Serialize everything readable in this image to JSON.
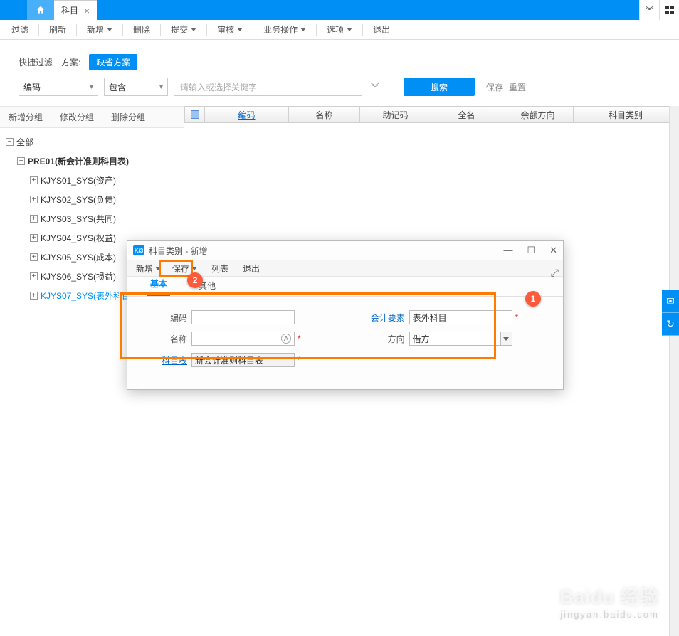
{
  "tabs": {
    "main_label": "科目"
  },
  "toolbar": {
    "filter": "过滤",
    "refresh": "刷新",
    "new": "新增",
    "delete": "删除",
    "submit": "提交",
    "audit": "审核",
    "bizops": "业务操作",
    "options": "选项",
    "exit": "退出"
  },
  "quickfilter": {
    "label": "快捷过滤",
    "scheme_label": "方案:",
    "scheme_value": "缺省方案"
  },
  "search": {
    "field": "编码",
    "op": "包含",
    "keyword_ph": "请输入或选择关键字",
    "btn": "搜索",
    "save": "保存",
    "reset": "重置"
  },
  "sidebar_hdr": {
    "add": "新增分组",
    "edit": "修改分组",
    "del": "删除分组"
  },
  "tree": {
    "all": "全部",
    "root": "PRE01(新会计准则科目表)",
    "nodes": [
      "KJYS01_SYS(资产)",
      "KJYS02_SYS(负债)",
      "KJYS03_SYS(共同)",
      "KJYS04_SYS(权益)",
      "KJYS05_SYS(成本)",
      "KJYS06_SYS(损益)",
      "KJYS07_SYS(表外科目)"
    ]
  },
  "grid_cols": {
    "c0": "编码",
    "c1": "名称",
    "c2": "助记码",
    "c3": "全名",
    "c4": "余额方向",
    "c5": "科目类别"
  },
  "dialog": {
    "title": "科目类别 - 新增",
    "tb": {
      "new": "新增",
      "save": "保存",
      "list": "列表",
      "exit": "退出"
    },
    "tabs": {
      "basic": "基本",
      "other": "其他"
    },
    "labels": {
      "code": "编码",
      "name": "名称",
      "table": "科目表",
      "elem": "会计要素",
      "dir": "方向"
    },
    "values": {
      "table": "新会计准则科目表",
      "elem": "表外科目",
      "dir": "借方"
    }
  },
  "callouts": {
    "b1": "1",
    "b2": "2"
  },
  "watermark": {
    "brand": "Baidu 经验",
    "sub": "jingyan.baidu.com"
  }
}
